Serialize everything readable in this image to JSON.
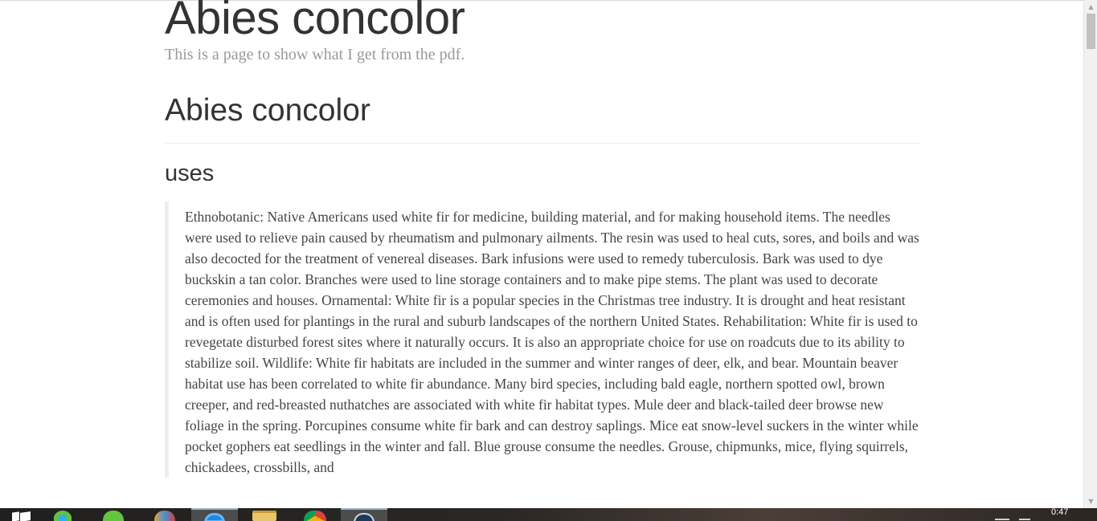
{
  "header": {
    "site_title": "Abies concolor",
    "subtitle": "This is a page to show what I get from the pdf."
  },
  "main": {
    "page_title": "Abies concolor",
    "section_heading": "uses",
    "uses_text": "Ethnobotanic: Native Americans used white fir for medicine, building material, and for making household items. The needles were used to relieve pain caused by rheumatism and pulmonary ailments. The resin was used to heal cuts, sores, and boils and was also decocted for the treatment of venereal diseases. Bark infusions were used to remedy tuberculosis. Bark was used to dye buckskin a tan color. Branches were used to line storage containers and to make pipe stems. The plant was used to decorate ceremonies and houses. Ornamental: White fir is a popular species in the Christmas tree industry. It is drought and heat resistant and is often used for plantings in the rural and suburb landscapes of the northern United States. Rehabilitation: White fir is used to revegetate disturbed forest sites where it naturally occurs. It is also an appropriate choice for use on roadcuts due to its ability to stabilize soil. Wildlife: White fir habitats are included in the summer and winter ranges of deer, elk, and bear. Mountain beaver habitat use has been correlated to white fir abundance. Many bird species, including bald eagle, northern spotted owl, brown creeper, and red-breasted nuthatches are associated with white fir habitat types. Mule deer and black-tailed deer browse new foliage in the spring. Porcupines consume white fir bark and can destroy saplings. Mice eat snow-level suckers in the winter while pocket gophers eat seedlings in the winter and fall. Blue grouse consume the needles. Grouse, chipmunks, mice, flying squirrels, chickadees, crossbills, and"
  },
  "scrollbar": {
    "up_icon": "up-arrow-icon",
    "down_icon": "down-arrow-icon"
  },
  "taskbar": {
    "clock": "0:47",
    "icons": [
      "windows-start-icon",
      "clover-app-icon",
      "wechat-icon",
      "paint-icon",
      "browser-icon",
      "file-explorer-icon",
      "chrome-icon",
      "steam-icon"
    ]
  },
  "colors": {
    "text_dark": "#333333",
    "text_body": "#444444",
    "subtitle": "#999999",
    "rule": "#eeeeee",
    "taskbar": "#202020"
  }
}
